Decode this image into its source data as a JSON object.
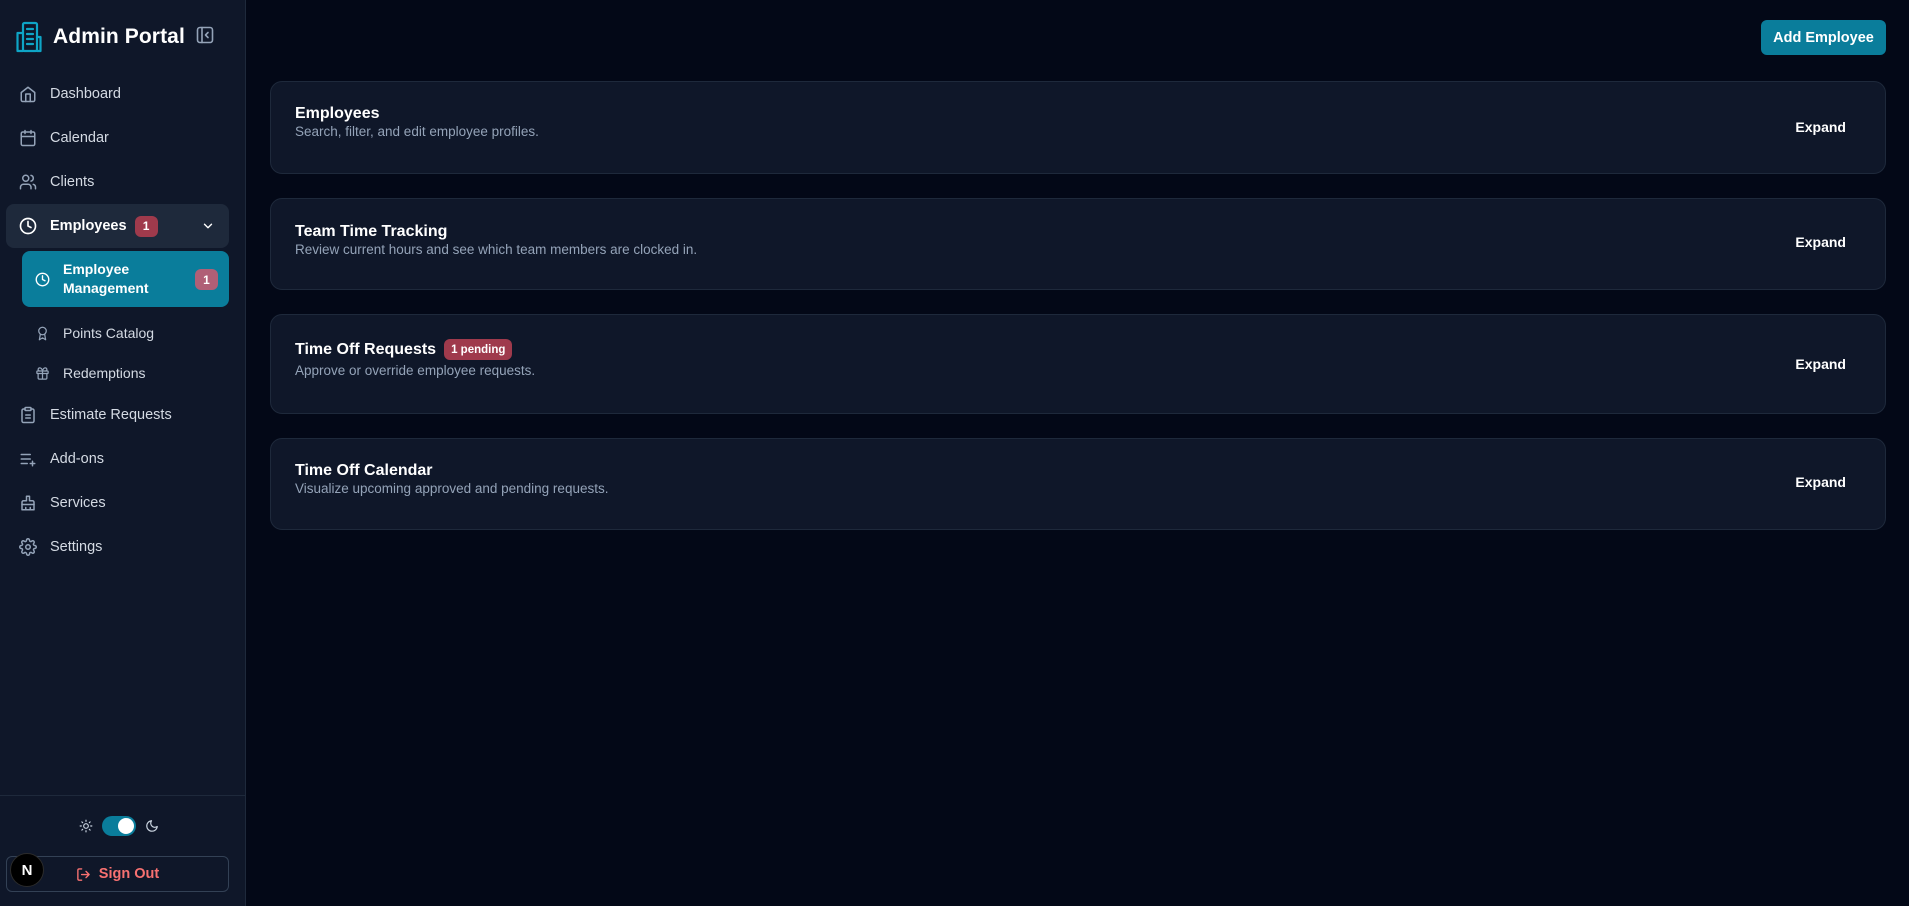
{
  "brand": {
    "title": "Admin Portal",
    "logo_icon": "building-icon"
  },
  "sidebar": {
    "items": [
      {
        "label": "Dashboard",
        "icon": "home-icon"
      },
      {
        "label": "Calendar",
        "icon": "calendar-icon"
      },
      {
        "label": "Clients",
        "icon": "users-icon"
      },
      {
        "label": "Employees",
        "icon": "clock-icon",
        "badge": "1"
      },
      {
        "label": "Estimate Requests",
        "icon": "clipboard-icon"
      },
      {
        "label": "Add-ons",
        "icon": "list-plus-icon"
      },
      {
        "label": "Services",
        "icon": "brush-icon"
      },
      {
        "label": "Settings",
        "icon": "gear-icon"
      }
    ],
    "sub_items": [
      {
        "label": "Employee Management",
        "icon": "clock-icon",
        "badge": "1",
        "active": true
      },
      {
        "label": "Points Catalog",
        "icon": "award-icon"
      },
      {
        "label": "Redemptions",
        "icon": "gift-icon"
      }
    ],
    "footer": {
      "sign_out": "Sign Out",
      "avatar_letter": "N",
      "theme": "dark"
    }
  },
  "main": {
    "add_button": "Add Employee",
    "cards": [
      {
        "title": "Employees",
        "description": "Search, filter, and edit employee profiles.",
        "action": "Expand"
      },
      {
        "title": "Team Time Tracking",
        "description": "Review current hours and see which team members are clocked in.",
        "action": "Expand"
      },
      {
        "title": "Time Off Requests",
        "badge": "1 pending",
        "description": "Approve or override employee requests.",
        "action": "Expand"
      },
      {
        "title": "Time Off Calendar",
        "description": "Visualize upcoming approved and pending requests.",
        "action": "Expand"
      }
    ]
  },
  "colors": {
    "accent": "#0a7d9b",
    "badge": "#9f3a4c",
    "danger": "#f87171",
    "background": "#030817",
    "panel": "#0f1729"
  }
}
